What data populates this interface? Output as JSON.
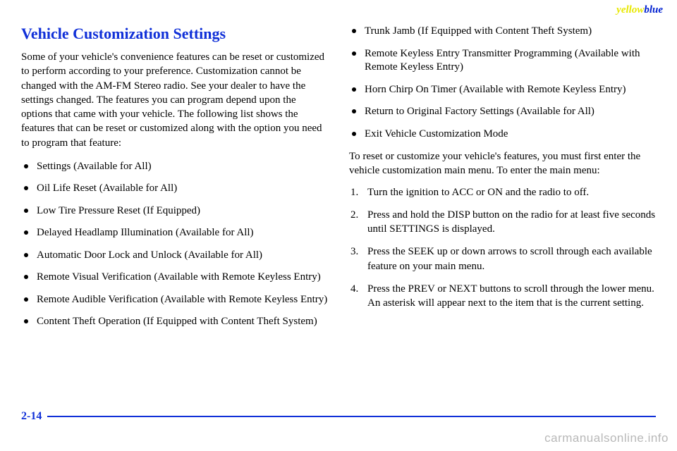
{
  "header": {
    "yellow": "yellow",
    "blue": "blue"
  },
  "title": "Vehicle Customization Settings",
  "intro": "Some of your vehicle's convenience features can be reset or customized to perform according to your preference. Customization cannot be changed with the AM-FM Stereo radio. See your dealer to have the settings changed. The features you can program depend upon the options that came with your vehicle. The following list shows the features that can be reset or customized along with the option you need to program that feature:",
  "features_left": [
    "Settings (Available for All)",
    "Oil Life Reset (Available for All)",
    "Low Tire Pressure Reset (If Equipped)",
    "Delayed Headlamp Illumination (Available for All)",
    "Automatic Door Lock and Unlock (Available for All)",
    "Remote Visual Verification (Available with Remote Keyless Entry)",
    "Remote Audible Verification (Available with Remote Keyless Entry)",
    "Content Theft Operation (If Equipped with Content Theft System)"
  ],
  "features_right": [
    "Trunk Jamb (If Equipped with Content Theft System)",
    "Remote Keyless Entry Transmitter Programming (Available with Remote Keyless Entry)",
    "Horn Chirp On Timer (Available with Remote Keyless Entry)",
    "Return to Original Factory Settings (Available for All)",
    "Exit Vehicle Customization Mode"
  ],
  "para2": "To reset or customize your vehicle's features, you must first enter the vehicle customization main menu. To enter the main menu:",
  "steps": [
    "Turn the ignition to ACC or ON and the radio to off.",
    "Press and hold the DISP button on the radio for at least five seconds until SETTINGS is displayed.",
    "Press the SEEK up or down arrows to scroll through each available feature on your main menu.",
    "Press the PREV or NEXT buttons to scroll through the lower menu. An asterisk will appear next to the item that is the current setting."
  ],
  "page_number": "2-14",
  "watermark": "carmanualsonline.info"
}
